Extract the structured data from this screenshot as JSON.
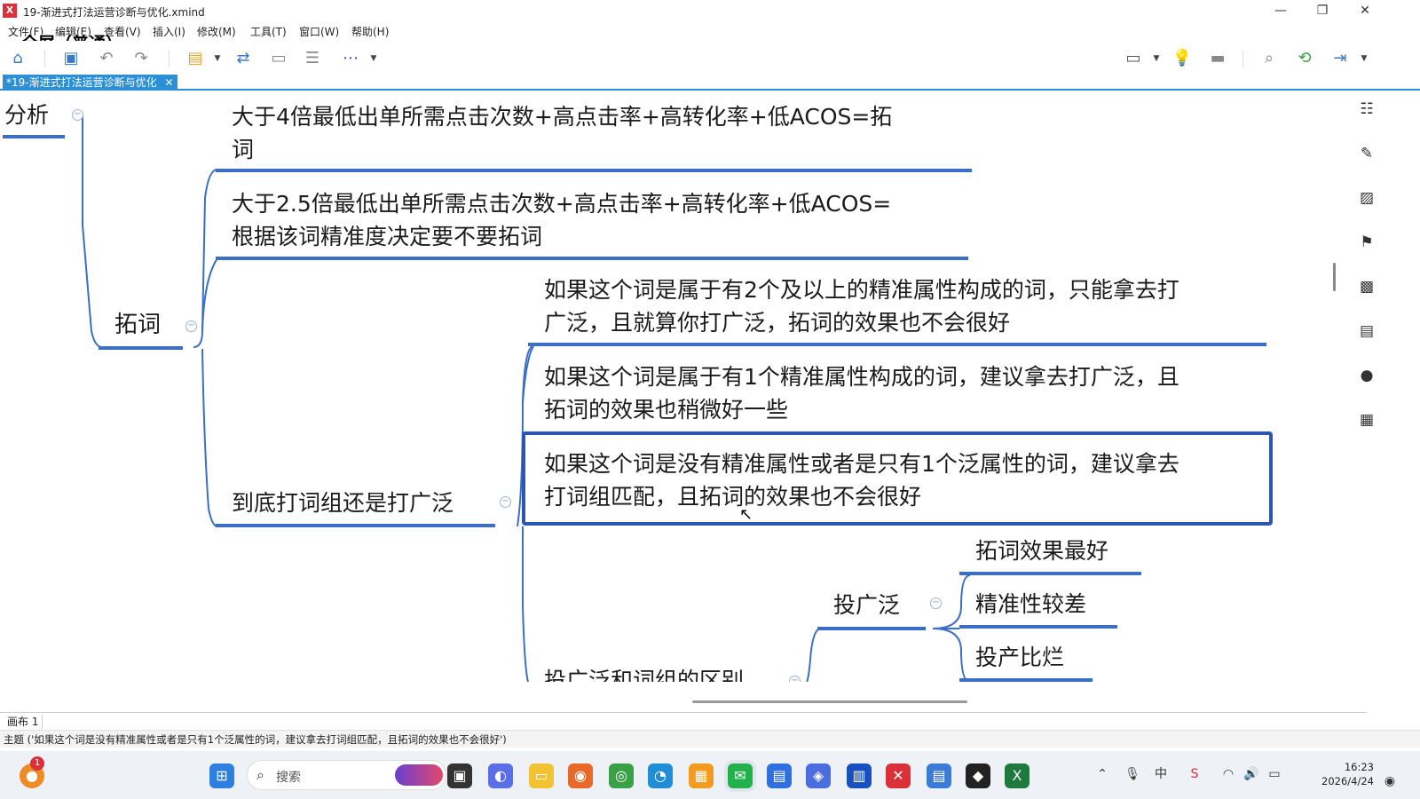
{
  "window": {
    "logo": "X",
    "title": "19-渐进式打法运营诊断与优化.xmind",
    "minimize": "—",
    "maximize": "❐",
    "close": "✕"
  },
  "menu": [
    "文件(F)",
    "编辑(E)",
    "查看(V)",
    "插入(I)",
    "修改(M)",
    "工具(T)",
    "窗口(W)",
    "帮助(H)"
  ],
  "overlay_text": "全屏（普通）",
  "toolbar_icons": [
    "home-icon",
    "save-icon",
    "undo-icon",
    "redo-icon",
    "insert-topic-icon",
    "relationship-icon",
    "boundary-icon",
    "summary-icon",
    "more-icon",
    "presentation-icon",
    "idea-icon",
    "layout-icon",
    "search-icon",
    "share-icon",
    "export-icon"
  ],
  "tab": {
    "label": "*19-渐进式打法运营诊断与优化",
    "close": "✕"
  },
  "mindmap": {
    "root_partial": "分析",
    "branch_tuoci": "拓词",
    "topic_4x_line1": "大于4倍最低出单所需点击次数+高点击率+高转化率+低ACOS=拓",
    "topic_4x_line2": "词",
    "topic_25x_line1": "大于2.5倍最低出单所需点击次数+高点击率+高转化率+低ACOS=",
    "topic_25x_line2": "根据该词精准度决定要不要拓词",
    "branch_group": "到底打词组还是打广泛",
    "sub1_line1": "如果这个词是属于有2个及以上的精准属性构成的词，只能拿去打",
    "sub1_line2": "广泛，且就算你打广泛，拓词的效果也不会很好",
    "sub2_line1": "如果这个词是属于有1个精准属性构成的词，建议拿去打广泛，且",
    "sub2_line2": "拓词的效果也稍微好一些",
    "sub3_line1": "如果这个词是没有精准属性或者是只有1个泛属性的词，建议拿去",
    "sub3_line2": "打词组匹配，且拓词的效果也不会很好",
    "branch_diff_partial": "投广泛和词组的区别",
    "branch_broad": "投广泛",
    "leaf1": "拓词效果最好",
    "leaf2": "精准性较差",
    "leaf3": "投产比烂",
    "collapse_symbol": "−"
  },
  "sheet": {
    "label": "画布 1"
  },
  "status": {
    "text": "主题 ('如果这个词是没有精准属性或者是只有1个泛属性的词，建议拿去打词组匹配，且拓词的效果也不会很好')"
  },
  "taskbar": {
    "search_placeholder": "搜索",
    "badge": "1",
    "clock_time": "16:23",
    "clock_date": "2026/4/24",
    "tray_lang": "中"
  },
  "colors": {
    "accent": "#2d8fd5",
    "branch_line": "#3a6fc4",
    "selected": "#2c56b4"
  }
}
